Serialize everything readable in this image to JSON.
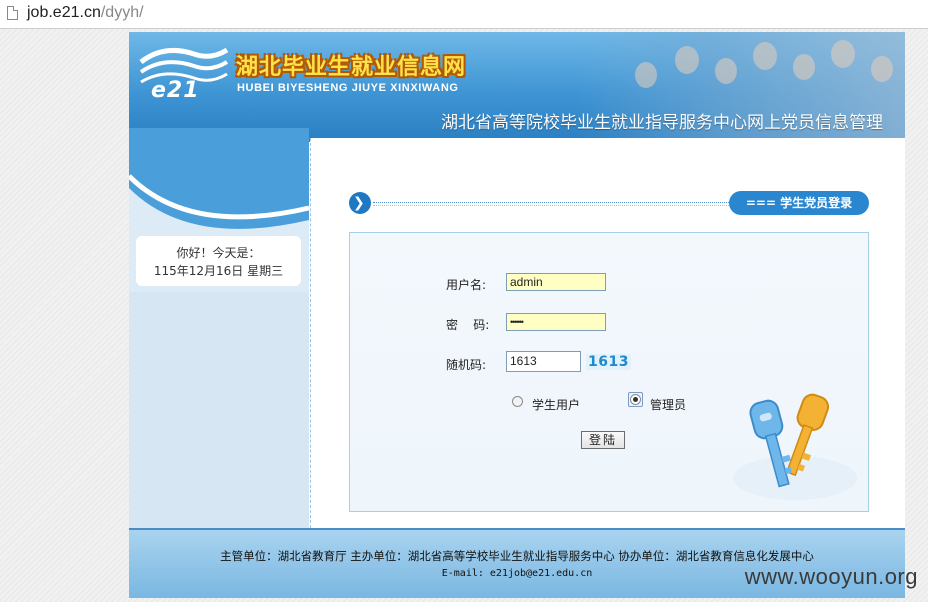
{
  "browser": {
    "url_host": "job.e21.cn",
    "url_path": "/dyyh/"
  },
  "header": {
    "logo_text": "e21",
    "site_title": "湖北毕业生就业信息网",
    "site_pinyin": "HUBEI BIYESHENG JIUYE XINXIWANG",
    "subtitle": "湖北省高等院校毕业生就业指导服务中心网上党员信息管理"
  },
  "sidebar": {
    "greeting": "你好！今天是：",
    "date": "115年12月16日  星期三"
  },
  "login": {
    "section_title": "=== 学生党员登录 ===",
    "username_label": "用户名:",
    "username_value": "admin",
    "password_label": "密    码:",
    "password_value": "••••••",
    "captcha_label": "随机码:",
    "captcha_input_value": "1613",
    "captcha_image_text": "1613",
    "role_options": [
      "学生用户",
      "管理员"
    ],
    "selected_role": "管理员",
    "submit_label": "登陆"
  },
  "footer": {
    "line1": "主管单位：湖北省教育厅  主办单位：湖北省高等学校毕业生就业指导服务中心  协办单位：湖北省教育信息化发展中心",
    "line2": "E-mail:  e21job@e21.edu.cn"
  },
  "watermark": "www.wooyun.org",
  "colors": {
    "banner_blue": "#3f95d4",
    "title_yellow": "#ffe14a",
    "pill_blue": "#2a86cf",
    "input_yellow": "#ffffc4",
    "footer_blue": "#78b6e1"
  },
  "icons": [
    "page-icon",
    "arrow-right-icon",
    "keys-icon",
    "party-emblem-icon"
  ]
}
